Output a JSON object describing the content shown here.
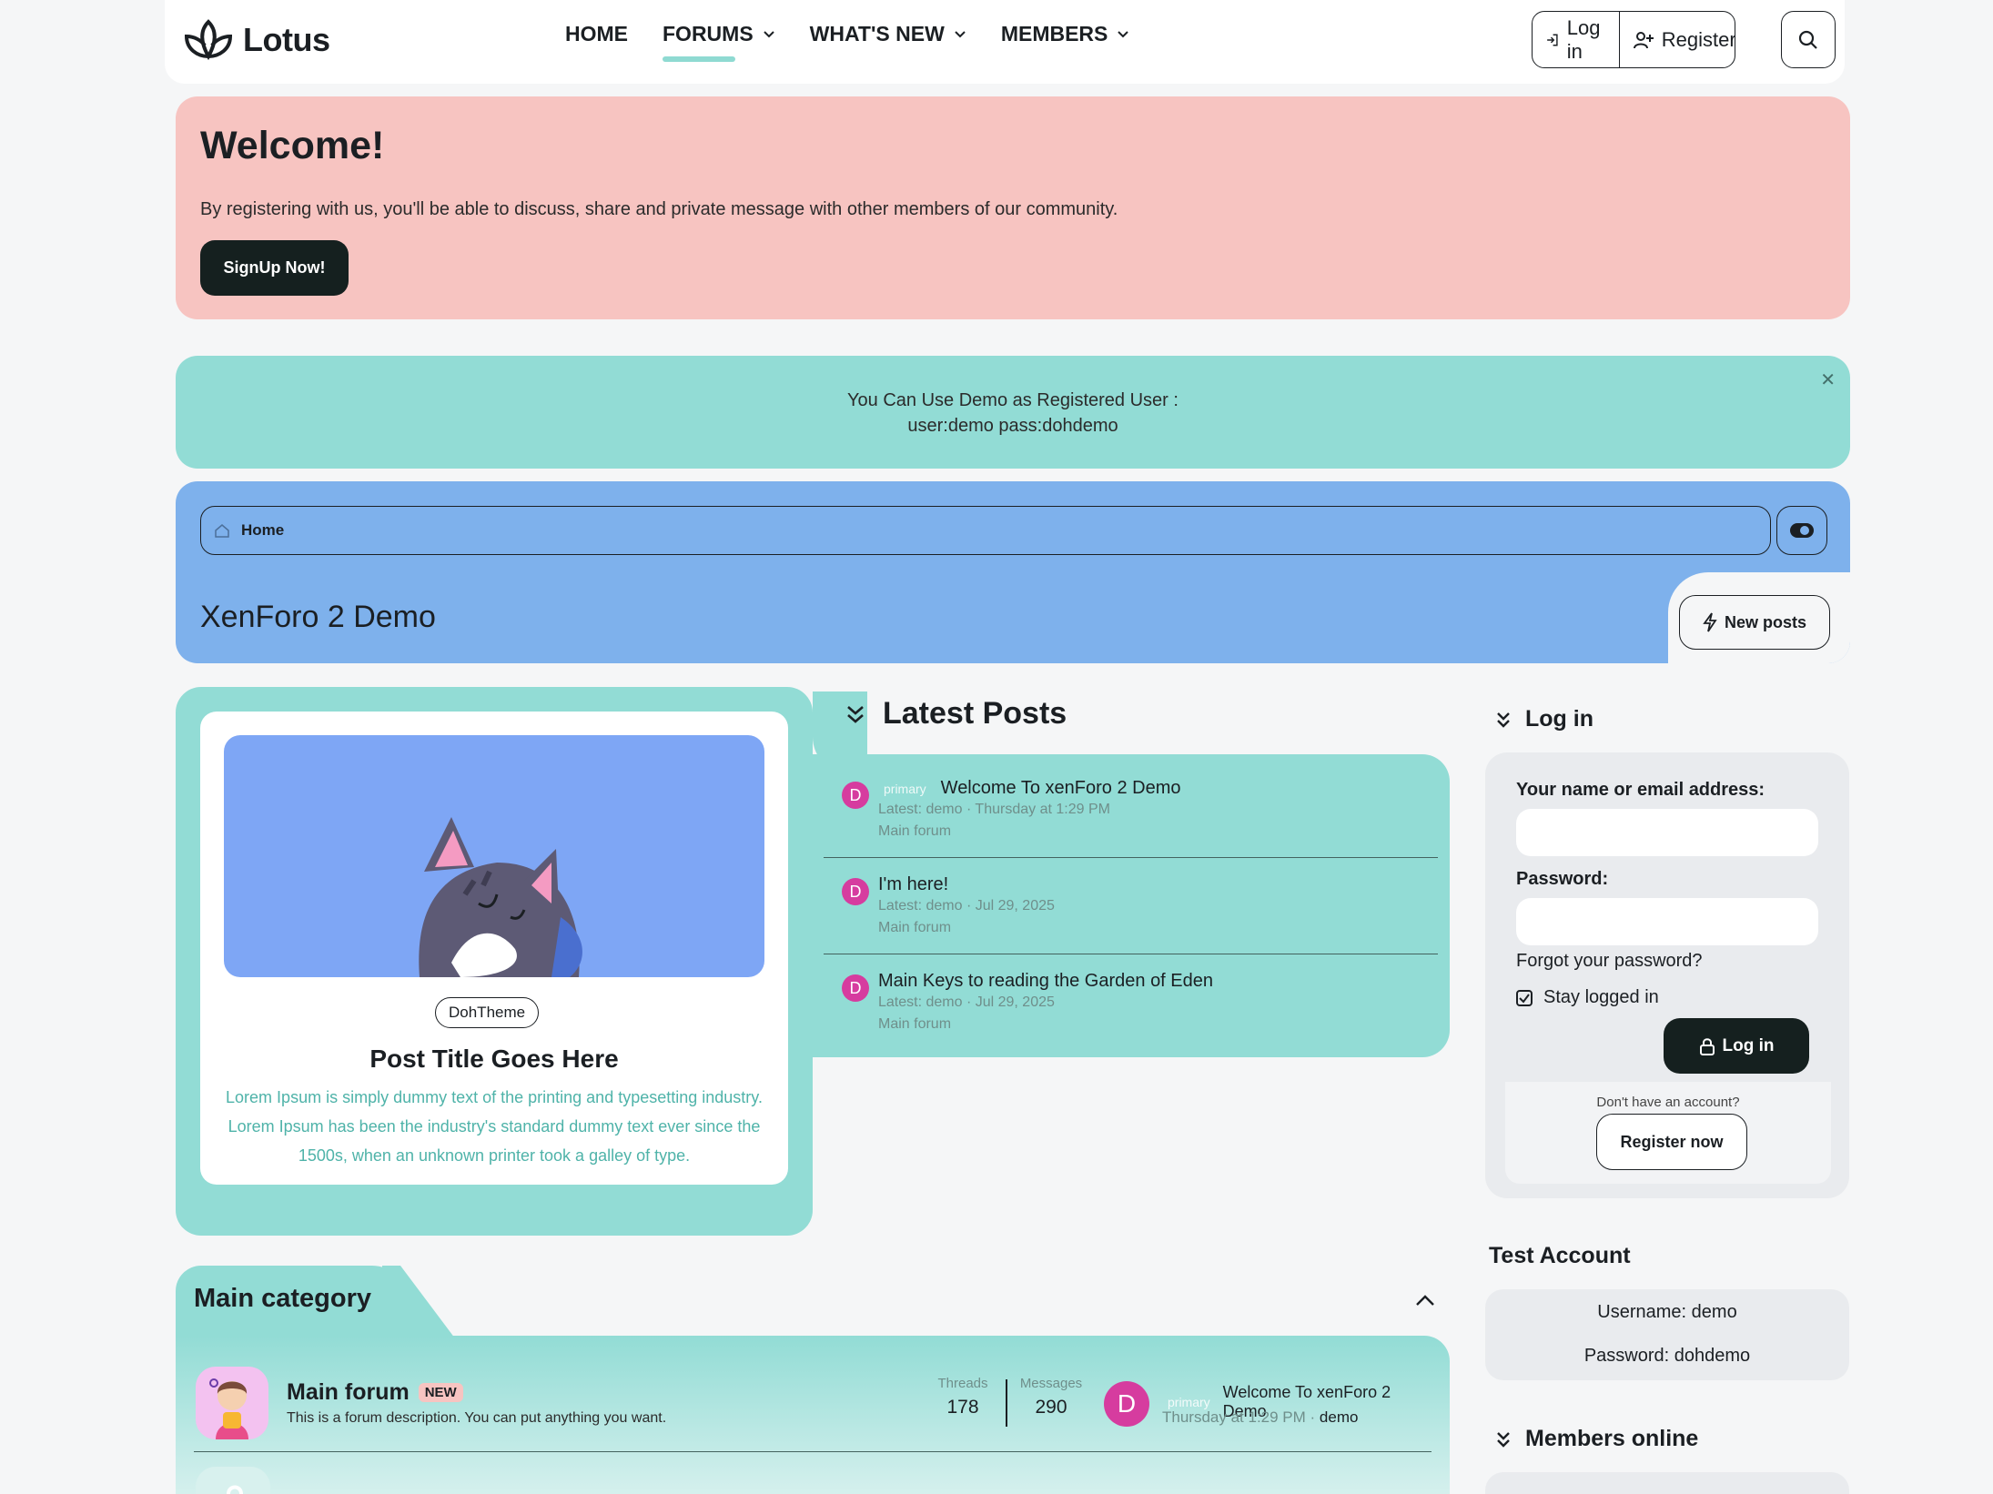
{
  "header": {
    "logo_text": "Lotus",
    "nav": [
      {
        "label": "HOME",
        "dropdown": false,
        "active": false
      },
      {
        "label": "FORUMS",
        "dropdown": true,
        "active": true
      },
      {
        "label": "WHAT'S NEW",
        "dropdown": true,
        "active": false
      },
      {
        "label": "MEMBERS",
        "dropdown": true,
        "active": false
      }
    ],
    "login_label": "Log in",
    "register_label": "Register"
  },
  "welcome": {
    "title": "Welcome!",
    "text": "By registering with us, you'll be able to discuss, share and private message with other members of our community.",
    "button": "SignUp Now!"
  },
  "notice": {
    "line1": "You Can Use Demo as Registered User :",
    "line2": "user:demo pass:dohdemo"
  },
  "breadcrumb": {
    "home": "Home"
  },
  "page_title": "XenForo 2 Demo",
  "new_posts_label": "New posts",
  "featured_post": {
    "tag": "DohTheme",
    "title": "Post Title Goes Here",
    "excerpt": "Lorem Ipsum is simply dummy text of the printing and typesetting industry. Lorem Ipsum has been the industry's standard dummy text ever since the 1500s, when an unknown printer took a galley of type."
  },
  "latest_posts": {
    "title": "Latest Posts",
    "items": [
      {
        "avatar": "D",
        "prefix": "primary",
        "title": "Welcome To xenForo 2 Demo",
        "meta": "Latest: demo · Thursday at 1:29 PM",
        "forum": "Main forum"
      },
      {
        "avatar": "D",
        "prefix": "",
        "title": "I'm here!",
        "meta": "Latest: demo · Jul 29, 2025",
        "forum": "Main forum"
      },
      {
        "avatar": "D",
        "prefix": "",
        "title": "Main Keys to reading the Garden of Eden",
        "meta": "Latest: demo · Jul 29, 2025",
        "forum": "Main forum"
      }
    ]
  },
  "sidebar": {
    "login": {
      "title": "Log in",
      "name_label": "Your name or email address:",
      "password_label": "Password:",
      "forgot": "Forgot your password?",
      "stay": "Stay logged in",
      "button": "Log in",
      "no_account": "Don't have an account?",
      "register": "Register now"
    },
    "test_account": {
      "title": "Test Account",
      "username": "Username: demo",
      "password": "Password: dohdemo"
    },
    "members_online": {
      "title": "Members online"
    }
  },
  "category": {
    "title": "Main category",
    "forum": {
      "name": "Main forum",
      "badge": "NEW",
      "description": "This is a forum description. You can put anything you want.",
      "threads_label": "Threads",
      "threads": "178",
      "messages_label": "Messages",
      "messages": "290",
      "last_avatar": "D",
      "last_prefix": "primary",
      "last_title": "Welcome To xenForo 2 Demo",
      "last_time": "Thursday at 1:29 PM",
      "last_user": "demo"
    }
  },
  "colors": {
    "welcome_bg": "#f7c4c1",
    "teal": "#92dcd5",
    "blue": "#7eb1ec",
    "dark_button": "#15201f",
    "avatar": "#d63c9f"
  }
}
